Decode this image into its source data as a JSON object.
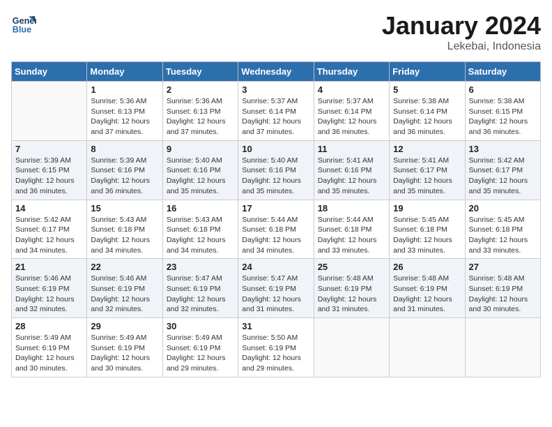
{
  "header": {
    "logo_line1": "General",
    "logo_line2": "Blue",
    "month": "January 2024",
    "location": "Lekebai, Indonesia"
  },
  "weekdays": [
    "Sunday",
    "Monday",
    "Tuesday",
    "Wednesday",
    "Thursday",
    "Friday",
    "Saturday"
  ],
  "weeks": [
    [
      {
        "day": "",
        "info": ""
      },
      {
        "day": "1",
        "info": "Sunrise: 5:36 AM\nSunset: 6:13 PM\nDaylight: 12 hours\nand 37 minutes."
      },
      {
        "day": "2",
        "info": "Sunrise: 5:36 AM\nSunset: 6:13 PM\nDaylight: 12 hours\nand 37 minutes."
      },
      {
        "day": "3",
        "info": "Sunrise: 5:37 AM\nSunset: 6:14 PM\nDaylight: 12 hours\nand 37 minutes."
      },
      {
        "day": "4",
        "info": "Sunrise: 5:37 AM\nSunset: 6:14 PM\nDaylight: 12 hours\nand 36 minutes."
      },
      {
        "day": "5",
        "info": "Sunrise: 5:38 AM\nSunset: 6:14 PM\nDaylight: 12 hours\nand 36 minutes."
      },
      {
        "day": "6",
        "info": "Sunrise: 5:38 AM\nSunset: 6:15 PM\nDaylight: 12 hours\nand 36 minutes."
      }
    ],
    [
      {
        "day": "7",
        "info": "Sunrise: 5:39 AM\nSunset: 6:15 PM\nDaylight: 12 hours\nand 36 minutes."
      },
      {
        "day": "8",
        "info": "Sunrise: 5:39 AM\nSunset: 6:16 PM\nDaylight: 12 hours\nand 36 minutes."
      },
      {
        "day": "9",
        "info": "Sunrise: 5:40 AM\nSunset: 6:16 PM\nDaylight: 12 hours\nand 35 minutes."
      },
      {
        "day": "10",
        "info": "Sunrise: 5:40 AM\nSunset: 6:16 PM\nDaylight: 12 hours\nand 35 minutes."
      },
      {
        "day": "11",
        "info": "Sunrise: 5:41 AM\nSunset: 6:16 PM\nDaylight: 12 hours\nand 35 minutes."
      },
      {
        "day": "12",
        "info": "Sunrise: 5:41 AM\nSunset: 6:17 PM\nDaylight: 12 hours\nand 35 minutes."
      },
      {
        "day": "13",
        "info": "Sunrise: 5:42 AM\nSunset: 6:17 PM\nDaylight: 12 hours\nand 35 minutes."
      }
    ],
    [
      {
        "day": "14",
        "info": "Sunrise: 5:42 AM\nSunset: 6:17 PM\nDaylight: 12 hours\nand 34 minutes."
      },
      {
        "day": "15",
        "info": "Sunrise: 5:43 AM\nSunset: 6:18 PM\nDaylight: 12 hours\nand 34 minutes."
      },
      {
        "day": "16",
        "info": "Sunrise: 5:43 AM\nSunset: 6:18 PM\nDaylight: 12 hours\nand 34 minutes."
      },
      {
        "day": "17",
        "info": "Sunrise: 5:44 AM\nSunset: 6:18 PM\nDaylight: 12 hours\nand 34 minutes."
      },
      {
        "day": "18",
        "info": "Sunrise: 5:44 AM\nSunset: 6:18 PM\nDaylight: 12 hours\nand 33 minutes."
      },
      {
        "day": "19",
        "info": "Sunrise: 5:45 AM\nSunset: 6:18 PM\nDaylight: 12 hours\nand 33 minutes."
      },
      {
        "day": "20",
        "info": "Sunrise: 5:45 AM\nSunset: 6:18 PM\nDaylight: 12 hours\nand 33 minutes."
      }
    ],
    [
      {
        "day": "21",
        "info": "Sunrise: 5:46 AM\nSunset: 6:19 PM\nDaylight: 12 hours\nand 32 minutes."
      },
      {
        "day": "22",
        "info": "Sunrise: 5:46 AM\nSunset: 6:19 PM\nDaylight: 12 hours\nand 32 minutes."
      },
      {
        "day": "23",
        "info": "Sunrise: 5:47 AM\nSunset: 6:19 PM\nDaylight: 12 hours\nand 32 minutes."
      },
      {
        "day": "24",
        "info": "Sunrise: 5:47 AM\nSunset: 6:19 PM\nDaylight: 12 hours\nand 31 minutes."
      },
      {
        "day": "25",
        "info": "Sunrise: 5:48 AM\nSunset: 6:19 PM\nDaylight: 12 hours\nand 31 minutes."
      },
      {
        "day": "26",
        "info": "Sunrise: 5:48 AM\nSunset: 6:19 PM\nDaylight: 12 hours\nand 31 minutes."
      },
      {
        "day": "27",
        "info": "Sunrise: 5:48 AM\nSunset: 6:19 PM\nDaylight: 12 hours\nand 30 minutes."
      }
    ],
    [
      {
        "day": "28",
        "info": "Sunrise: 5:49 AM\nSunset: 6:19 PM\nDaylight: 12 hours\nand 30 minutes."
      },
      {
        "day": "29",
        "info": "Sunrise: 5:49 AM\nSunset: 6:19 PM\nDaylight: 12 hours\nand 30 minutes."
      },
      {
        "day": "30",
        "info": "Sunrise: 5:49 AM\nSunset: 6:19 PM\nDaylight: 12 hours\nand 29 minutes."
      },
      {
        "day": "31",
        "info": "Sunrise: 5:50 AM\nSunset: 6:19 PM\nDaylight: 12 hours\nand 29 minutes."
      },
      {
        "day": "",
        "info": ""
      },
      {
        "day": "",
        "info": ""
      },
      {
        "day": "",
        "info": ""
      }
    ]
  ]
}
